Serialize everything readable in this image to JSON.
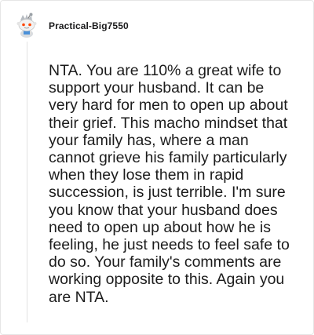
{
  "comment": {
    "author": "Practical-Big7550",
    "avatar_icon": "snoo-avatar-icon",
    "text": "NTA. You are 110% a great wife to support your husband. It can be very hard for men to open up about their grief. This macho mindset that your family has, where a man cannot grieve his family particularly when they lose them in rapid succession, is just terrible. I'm sure you know that your husband does need to open up about how he is feeling, he just needs to feel safe to do so. Your family's comments are working opposite to this. Again you are NTA."
  },
  "colors": {
    "text": "#1c1c1c",
    "border": "#e6e6e6",
    "avatar_face": "#f2f2f2",
    "avatar_eye": "#ff4500"
  }
}
